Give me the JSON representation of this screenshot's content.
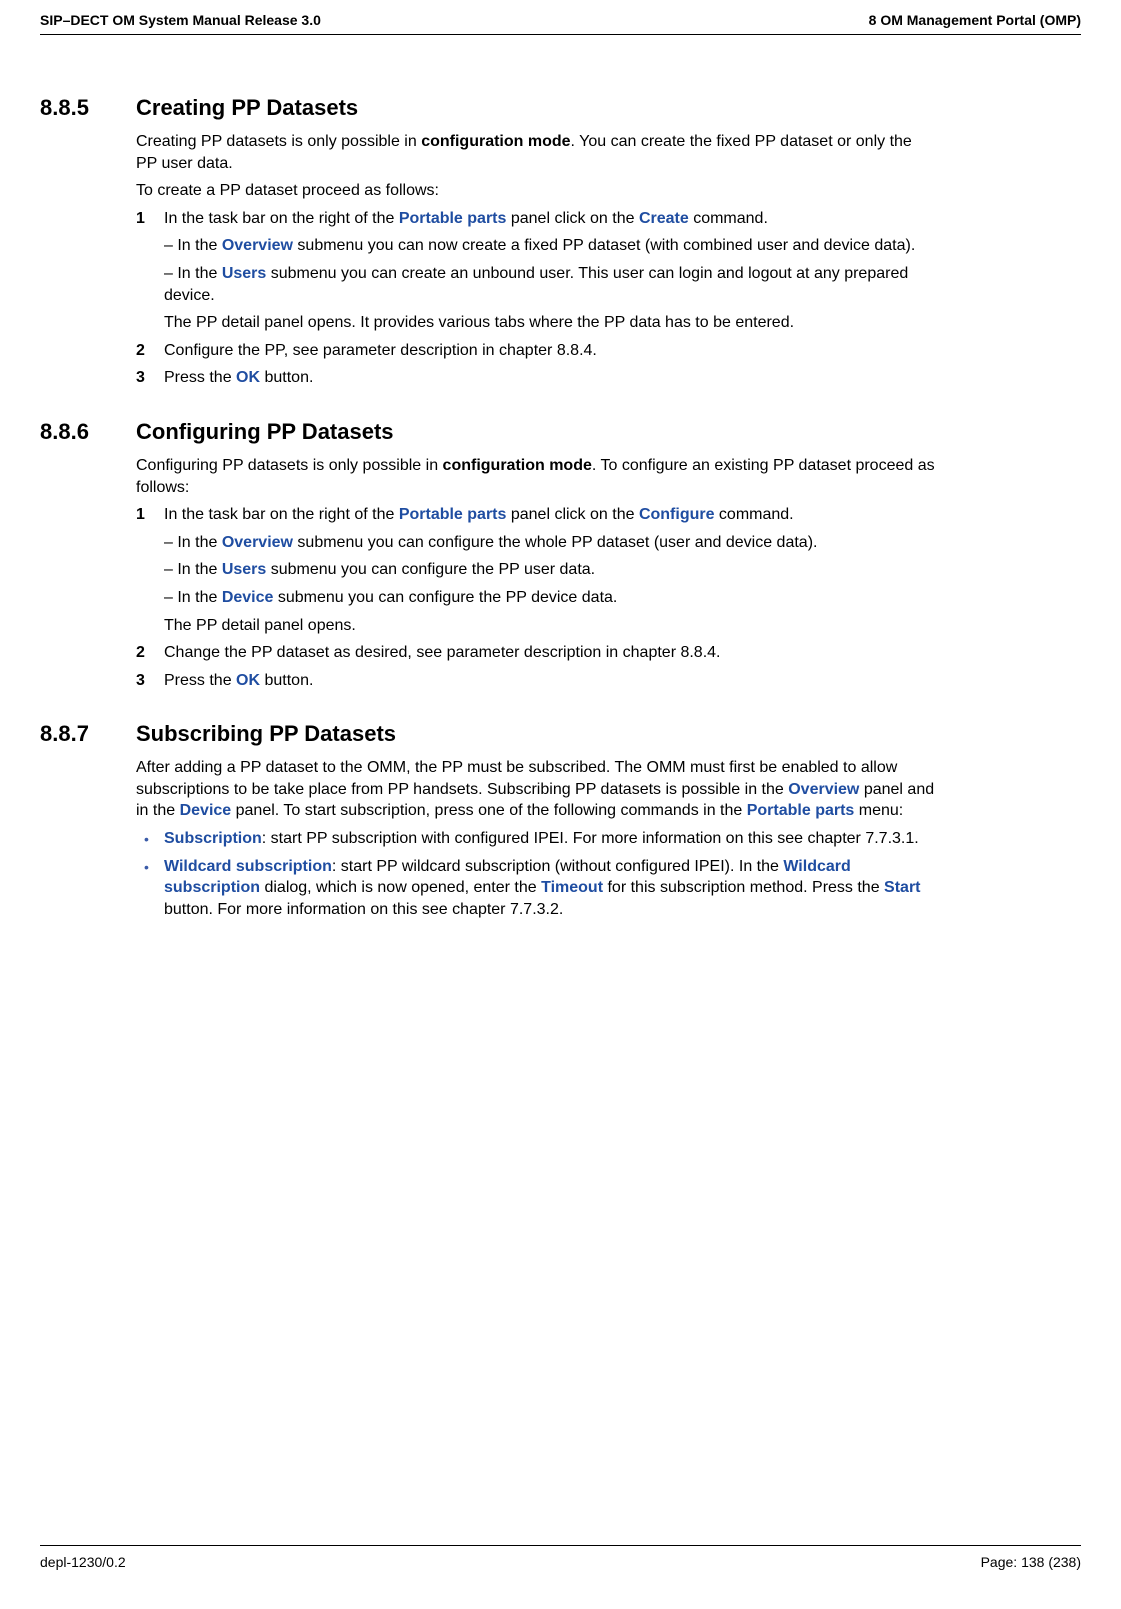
{
  "header": {
    "left": "SIP–DECT OM System Manual Release 3.0",
    "right": "8 OM Management Portal (OMP)"
  },
  "sections": {
    "s885": {
      "number": "8.8.5",
      "title": "Creating PP Datasets",
      "p1a": "Creating PP datasets is only possible in ",
      "p1b": "configuration mode",
      "p1c": ". You can create the fixed PP dataset or only the PP user data.",
      "p2": "To create a PP dataset proceed as follows:",
      "step1_num": "1",
      "step1a": "In the task bar on the right of the ",
      "step1b": "Portable parts",
      "step1c": " panel click on the ",
      "step1d": "Create",
      "step1e": " command.",
      "sub1a": "– In the ",
      "sub1b": "Overview",
      "sub1c": " submenu you can now create a fixed PP dataset (with combined user and device data).",
      "sub2a": "– In the ",
      "sub2b": "Users",
      "sub2c": " submenu you can create an unbound user. This user can login and logout at any prepared device.",
      "sub3": "The PP detail panel opens. It provides various tabs where the PP data has to be entered.",
      "step2_num": "2",
      "step2": "Configure the PP, see parameter description in chapter 8.8.4.",
      "step3_num": "3",
      "step3a": "Press the ",
      "step3b": "OK",
      "step3c": " button."
    },
    "s886": {
      "number": "8.8.6",
      "title": "Configuring PP Datasets",
      "p1a": "Configuring PP datasets is only possible in ",
      "p1b": "configuration mode",
      "p1c": ". To configure an existing PP dataset proceed as follows:",
      "step1_num": "1",
      "step1a": "In the task bar on the right of the ",
      "step1b": "Portable parts",
      "step1c": " panel click on the ",
      "step1d": "Configure",
      "step1e": " command.",
      "sub1a": "– In the ",
      "sub1b": "Overview",
      "sub1c": " submenu you can configure the whole PP dataset (user and device data).",
      "sub2a": "– In the ",
      "sub2b": "Users",
      "sub2c": " submenu you can configure the PP user data.",
      "sub3a": "– In the ",
      "sub3b": "Device",
      "sub3c": " submenu you can configure the PP device data.",
      "sub4": "The PP detail panel opens.",
      "step2_num": "2",
      "step2": "Change the PP dataset as desired, see parameter description in chapter 8.8.4.",
      "step3_num": "3",
      "step3a": "Press the ",
      "step3b": "OK",
      "step3c": " button."
    },
    "s887": {
      "number": "8.8.7",
      "title": "Subscribing PP Datasets",
      "p1a": "After adding a PP dataset to the OMM, the PP must be subscribed. The OMM must first be enabled to allow subscriptions to be take place from PP handsets. Subscribing PP datasets is possible in the ",
      "p1b": "Overview",
      "p1c": " panel and in the ",
      "p1d": "Device",
      "p1e": " panel. To start subscription, press one of the following commands in the ",
      "p1f": "Portable parts",
      "p1g": " menu:",
      "b1a": "Subscription",
      "b1b": ": start PP subscription with configured IPEI. For more information on this see chapter 7.7.3.1.",
      "b2a": "Wildcard subscription",
      "b2b": ": start PP wildcard subscription (without configured IPEI). In the ",
      "b2c": "Wildcard subscription",
      "b2d": " dialog, which is now opened, enter the ",
      "b2e": "Timeout",
      "b2f": " for this subscription method. Press the ",
      "b2g": "Start",
      "b2h": " button. For more information on this see chapter 7.7.3.2."
    }
  },
  "footer": {
    "left": "depl-1230/0.2",
    "right": "Page: 138 (238)"
  }
}
